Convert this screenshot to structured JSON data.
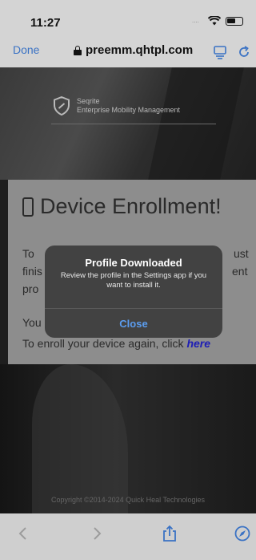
{
  "status_bar": {
    "time": "11:27",
    "signal_text": "....",
    "icons": [
      "wifi-icon",
      "battery-icon"
    ]
  },
  "browser": {
    "done_label": "Done",
    "url": "preemm.qhtpl.com",
    "icons": [
      "lock-icon",
      "reader-icon",
      "reload-icon"
    ]
  },
  "page": {
    "brand_name": "Seqrite",
    "brand_tagline": "Enterprise Mobility Management",
    "card": {
      "title": "Device Enrollment!",
      "line1_start": "To",
      "line1_end": "ust",
      "line2_start": "finis",
      "line2_end": "ent",
      "line3_start": "pro",
      "line4_start": "You",
      "line5_text": "To enroll your device again, click ",
      "line5_link": "here"
    },
    "copyright": "Copyright ©2014-2024 Quick Heal Technologies"
  },
  "alert": {
    "title": "Profile Downloaded",
    "message": "Review the profile in the Settings app if you want to install it.",
    "close_label": "Close"
  },
  "toolbar": {
    "icons": [
      "back-icon",
      "forward-icon",
      "share-icon",
      "compass-icon"
    ]
  },
  "colors": {
    "link_blue": "#3a72c4",
    "alert_button": "#5b9df0",
    "card_link": "#1d1db5"
  }
}
